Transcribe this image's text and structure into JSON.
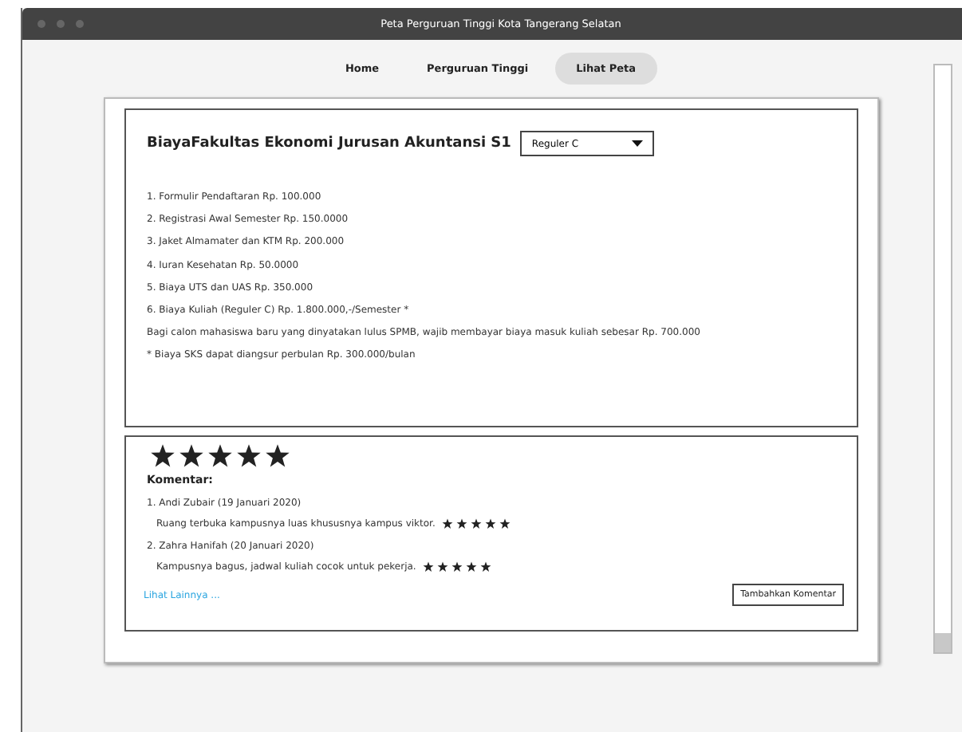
{
  "window": {
    "title": "Peta Perguruan Tinggi Kota Tangerang Selatan"
  },
  "tabs": [
    {
      "label": "Home",
      "selected": false
    },
    {
      "label": "Perguruan Tinggi",
      "selected": false
    },
    {
      "label": "Lihat Peta",
      "selected": true
    }
  ],
  "fees": {
    "title": "BiayaFakultas Ekonomi Jurusan Akuntansi S1",
    "dropdown": "Reguler C",
    "items": [
      "1. Formulir Pendaftaran Rp. 100.000",
      "2. Registrasi Awal Semester Rp. 150.0000",
      "3. Jaket Almamater dan KTM Rp. 200.000",
      "4. Iuran Kesehatan Rp. 50.0000",
      "5. Biaya UTS dan UAS Rp. 350.000",
      "6. Biaya Kuliah (Reguler C) Rp. 1.800.000,-/Semester *",
      "Bagi calon mahasiswa baru yang dinyatakan lulus SPMB, wajib membayar biaya masuk kuliah sebesar Rp. 700.000",
      "* Biaya SKS dapat diangsur perbulan Rp. 300.000/bulan"
    ]
  },
  "reviews": {
    "stars": 5,
    "heading": "Komentar:",
    "comments": [
      {
        "author": "1. Andi Zubair (19 Januari 2020)",
        "text": "Ruang terbuka kampusnya luas khususnya kampus viktor.",
        "stars": 5
      },
      {
        "author": "2. Zahra Hanifah (20 Januari 2020)",
        "text": "Kampusnya bagus, jadwal kuliah cocok untuk pekerja.",
        "stars": 5
      }
    ],
    "more_link": "Lihat Lainnya ...",
    "add_button": "Tambahkan Komentar"
  }
}
